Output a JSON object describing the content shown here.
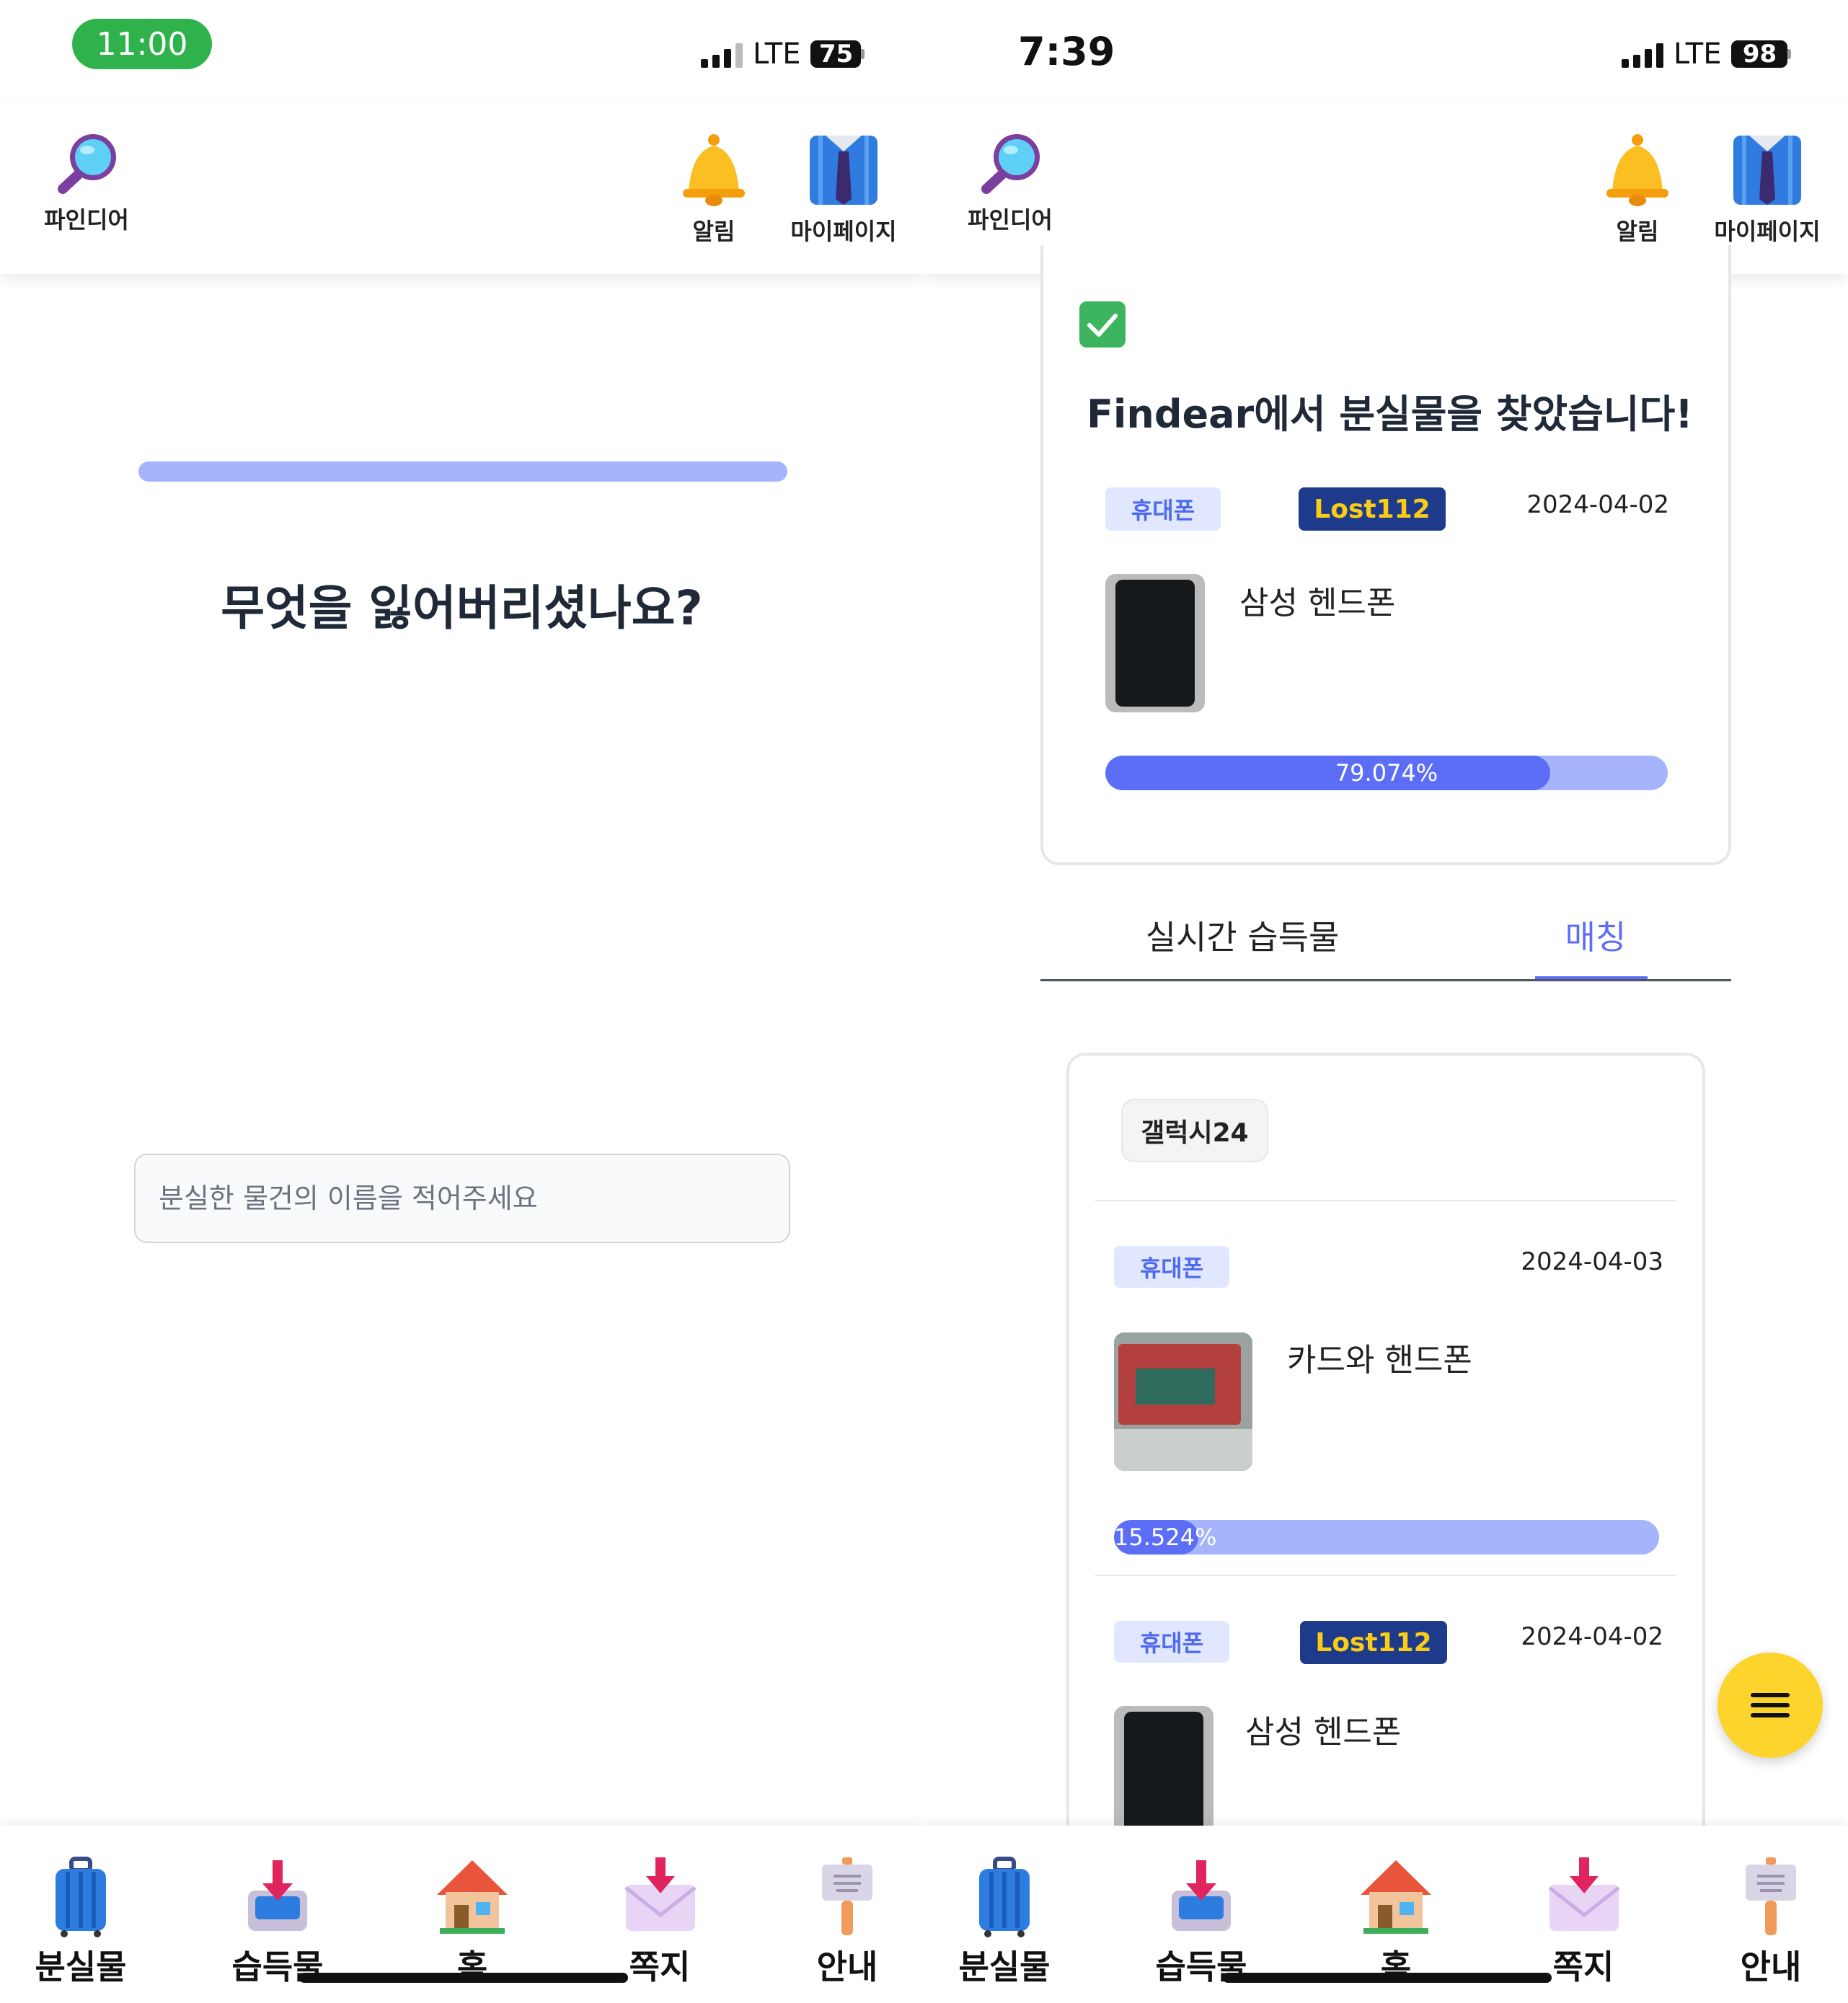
{
  "left": {
    "status": {
      "time": "11:00",
      "network": "LTE",
      "battery": "75"
    },
    "header": {
      "logo_label": "파인디어",
      "alarm_label": "알림",
      "mypage_label": "마이페이지"
    },
    "progress": {
      "value": 1.0
    },
    "question": "무엇을 잃어버리셨나요?",
    "search": {
      "placeholder": "분실한 물건의 이름을 적어주세요",
      "value": ""
    }
  },
  "right": {
    "status": {
      "time": "7:39",
      "network": "LTE",
      "battery": "98"
    },
    "header": {
      "logo_label": "파인디어",
      "alarm_label": "알림",
      "mypage_label": "마이페이지"
    },
    "found_card": {
      "title": "Findear에서 분실물을 찾았습니다!",
      "category": "휴대폰",
      "source": "Lost112",
      "date": "2024-04-02",
      "item_name": "삼성 헨드폰",
      "match_percent_text": "79.074%",
      "match_fraction": 0.79074
    },
    "tabs": [
      {
        "label": "실시간 습득물",
        "active": false
      },
      {
        "label": "매칭",
        "active": true
      }
    ],
    "match_list": {
      "query_chip": "갤럭시24",
      "items": [
        {
          "category": "휴대폰",
          "source": "",
          "date": "2024-04-03",
          "name": "카드와 핸드폰",
          "percent_text": "15.524%",
          "fraction": 0.15524
        },
        {
          "category": "휴대폰",
          "source": "Lost112",
          "date": "2024-04-02",
          "name": "삼성 헨드폰"
        }
      ]
    }
  },
  "bottom_nav": [
    "분실물",
    "습득물",
    "홈",
    "쪽지",
    "안내"
  ],
  "icons": {
    "logo": "magnifier-icon",
    "alarm": "bell-icon",
    "mypage": "shirt-tie-icon",
    "nav": [
      "luggage-icon",
      "inbox-tray-icon",
      "house-icon",
      "envelope-arrow-icon",
      "signpost-icon"
    ],
    "check": "check-mark-icon",
    "fab": "menu-icon"
  },
  "colors": {
    "accent": "#5b6ef5",
    "accent_light": "#a5b4fc",
    "badge_navy": "#1e3a8a",
    "badge_yellow": "#facc15",
    "fab": "#fcd42c",
    "status_green": "#2fb24c"
  }
}
